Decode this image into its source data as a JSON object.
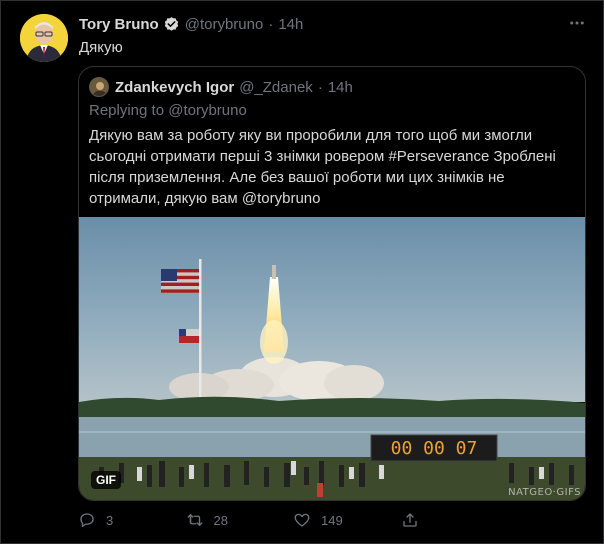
{
  "tweet": {
    "author_name": "Tory Bruno",
    "author_handle": "@torybruno",
    "time": "14h",
    "text": "Дякую"
  },
  "quoted": {
    "author_name": "Zdankevych Igor",
    "author_handle": "@_Zdanek",
    "time": "14h",
    "replying_to": "Replying to @torybruno",
    "text": "Дякую вам за роботу яку ви проробили для того щоб ми змогли сьогодні отримати перші 3 знімки ровером #Perseverance Зроблені після приземлення. Але без вашої роботи ми цих знімків не отримали, дякую вам @torybruno",
    "media": {
      "badge": "GIF",
      "clock": "00 00 07",
      "watermark": "NATGEO·GIFS"
    }
  },
  "actions": {
    "reply_count": "3",
    "retweet_count": "28",
    "like_count": "149"
  },
  "colors": {
    "background": "#000000",
    "text": "#d9d9d9",
    "secondary": "#6e767d",
    "border": "#2f3336",
    "verified": "#d9d9d9"
  },
  "icons": [
    "verified-badge-icon",
    "more-icon",
    "reply-icon",
    "retweet-icon",
    "like-icon",
    "share-icon"
  ]
}
